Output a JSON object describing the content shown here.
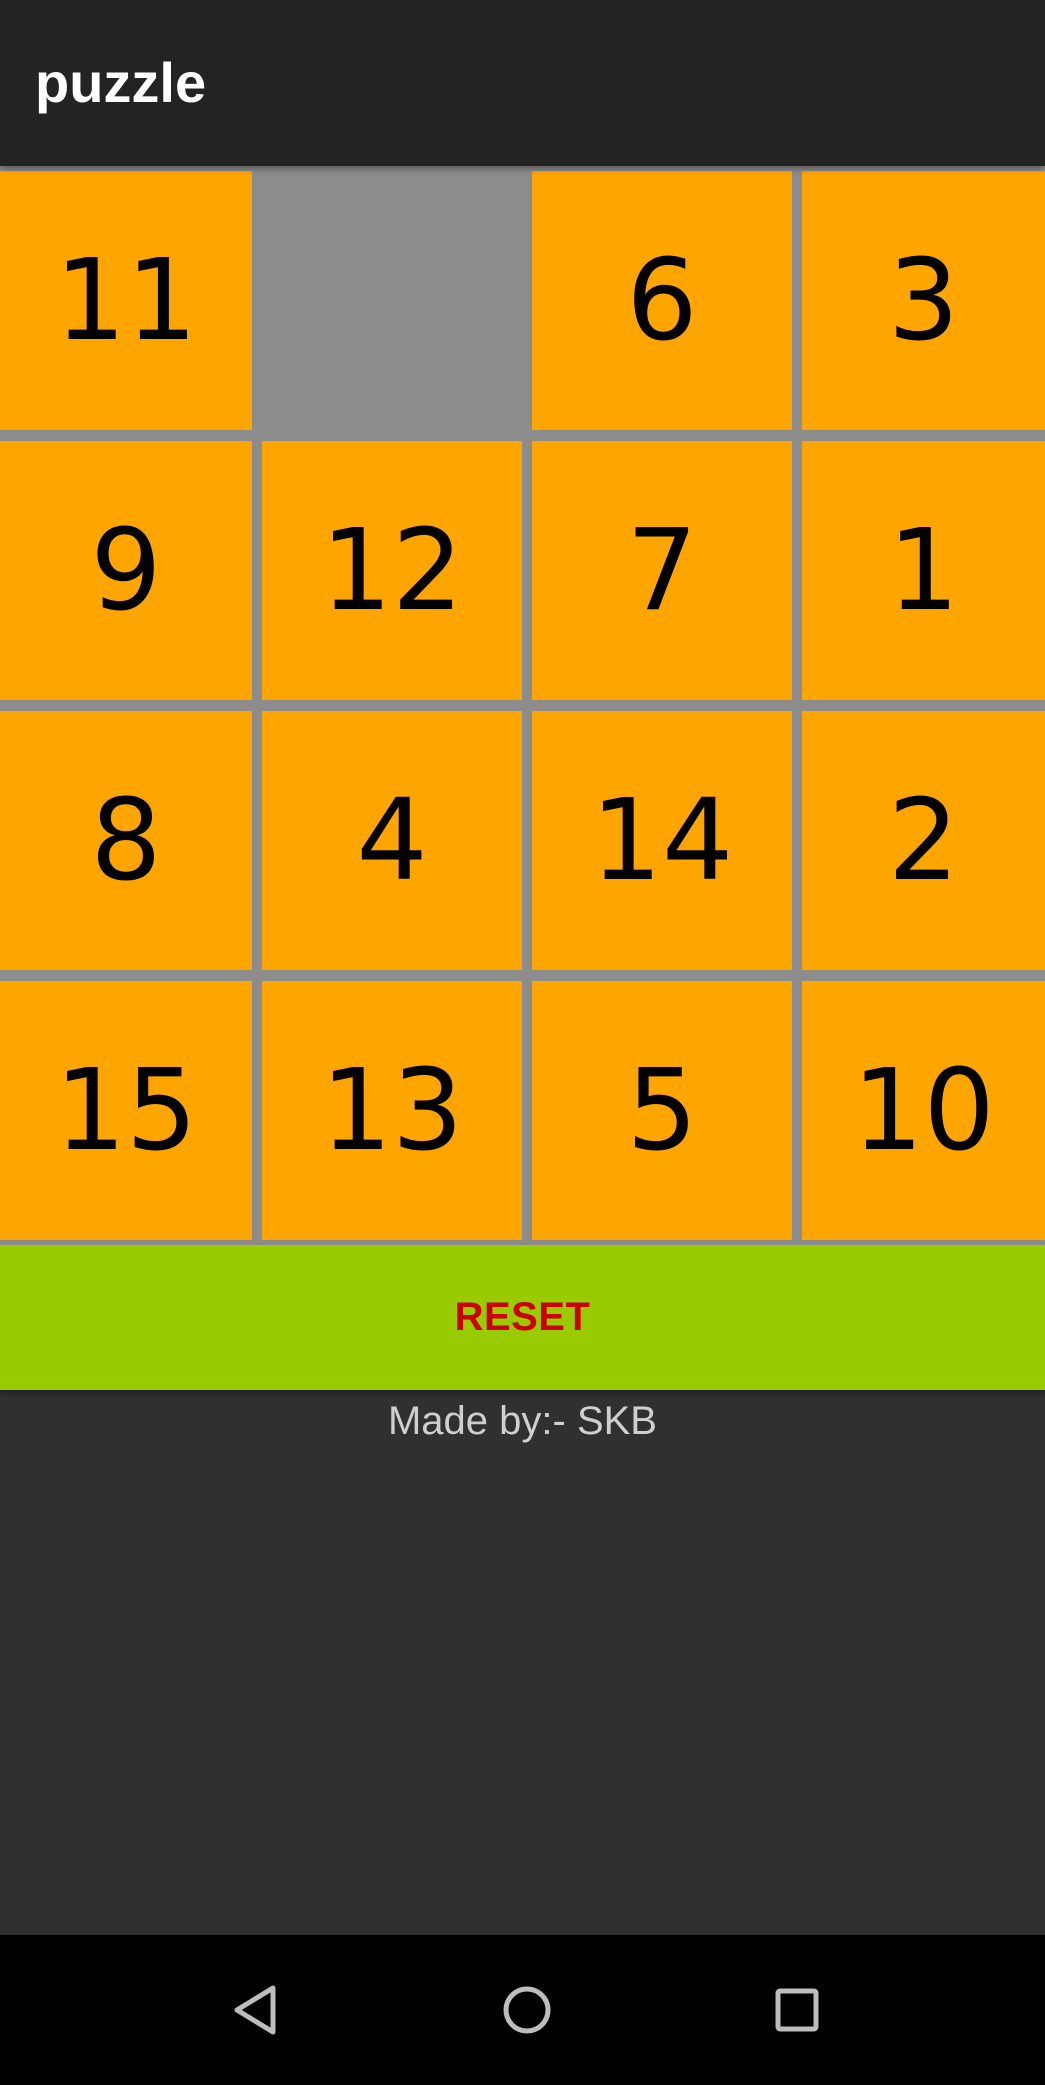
{
  "app_bar": {
    "title": "puzzle"
  },
  "board": {
    "rows": [
      [
        "11",
        "",
        "6",
        "3"
      ],
      [
        "9",
        "12",
        "7",
        "1"
      ],
      [
        "8",
        "4",
        "14",
        "2"
      ],
      [
        "15",
        "13",
        "5",
        "10"
      ]
    ],
    "colors": {
      "tile": "#ffa500",
      "empty": "#8c8c8c",
      "grid_line": "#8c8c8c",
      "number": "#000000"
    }
  },
  "reset_button": {
    "label": "RESET",
    "background": "#99cc00",
    "text_color": "#cc0000"
  },
  "footer": {
    "credit": "Made by:- SKB"
  },
  "nav_bar": {
    "icons": [
      "back-icon",
      "home-icon",
      "recents-icon"
    ]
  }
}
